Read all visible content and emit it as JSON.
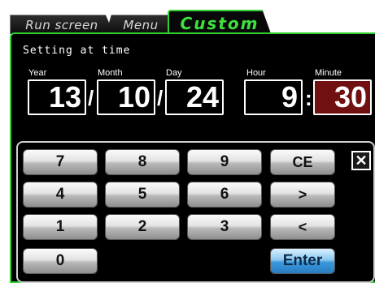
{
  "tabs": [
    {
      "label": "Run screen"
    },
    {
      "label": "Menu"
    },
    {
      "label": "Custom"
    }
  ],
  "page_title": "Setting at time",
  "fields": {
    "year": {
      "label": "Year",
      "value": "13"
    },
    "month": {
      "label": "Month",
      "value": "10"
    },
    "day": {
      "label": "Day",
      "value": "24"
    },
    "hour": {
      "label": "Hour",
      "value": "9"
    },
    "minute": {
      "label": "Minute",
      "value": "30"
    }
  },
  "separators": {
    "date": "/",
    "time": ":"
  },
  "keypad": {
    "k7": "7",
    "k8": "8",
    "k9": "9",
    "ce": "CE",
    "k4": "4",
    "k5": "5",
    "k6": "6",
    "right": ">",
    "k1": "1",
    "k2": "2",
    "k3": "3",
    "left": "<",
    "k0": "0",
    "enter": "Enter",
    "close": "✕"
  },
  "colors": {
    "accent_green": "#2fd02f",
    "active_field": "#701010",
    "enter_key": "#3a98dc"
  }
}
